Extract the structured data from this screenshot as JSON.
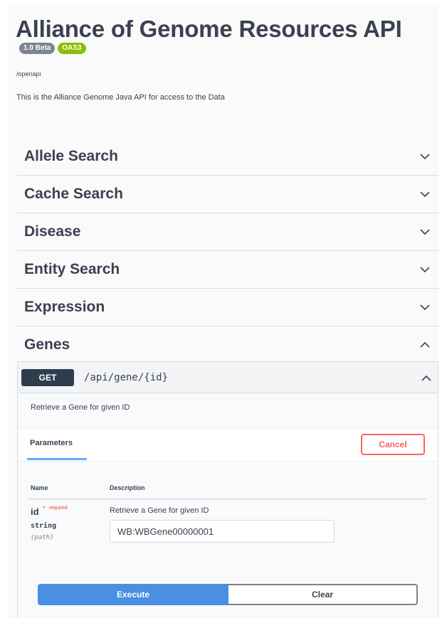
{
  "header": {
    "title": "Alliance of Genome Resources API",
    "version_badge": "1.0 Beta",
    "spec_badge": "OAS3",
    "url": "/openapi",
    "description": "This is the Alliance Genome Java API for access to the Data"
  },
  "tags": [
    {
      "label": "Allele Search",
      "state_icon": "chevron-down-icon"
    },
    {
      "label": "Cache Search",
      "state_icon": "chevron-down-icon"
    },
    {
      "label": "Disease",
      "state_icon": "chevron-down-icon"
    },
    {
      "label": "Entity Search",
      "state_icon": "chevron-down-icon"
    },
    {
      "label": "Expression",
      "state_icon": "chevron-down-icon"
    },
    {
      "label": "Genes",
      "state_icon": "chevron-up-icon"
    }
  ],
  "operation": {
    "method": "GET",
    "path": "/api/gene/{id}",
    "summary": "Retrieve a Gene for given ID",
    "parameters_tab": "Parameters",
    "cancel_label": "Cancel",
    "table_headers": {
      "name": "Name",
      "description": "Description"
    },
    "parameter": {
      "name": "id",
      "required_star": "*",
      "required_label": "required",
      "type": "string",
      "location": "(path)",
      "description": "Retrieve a Gene for given ID",
      "value": "WB:WBGene00000001"
    },
    "execute_label": "Execute",
    "clear_label": "Clear"
  },
  "colors": {
    "get_method": "#2f3e4e",
    "execute": "#4990e2",
    "cancel": "#ff6060",
    "oas_badge": "#89bf04",
    "version_badge": "#7d8492"
  }
}
